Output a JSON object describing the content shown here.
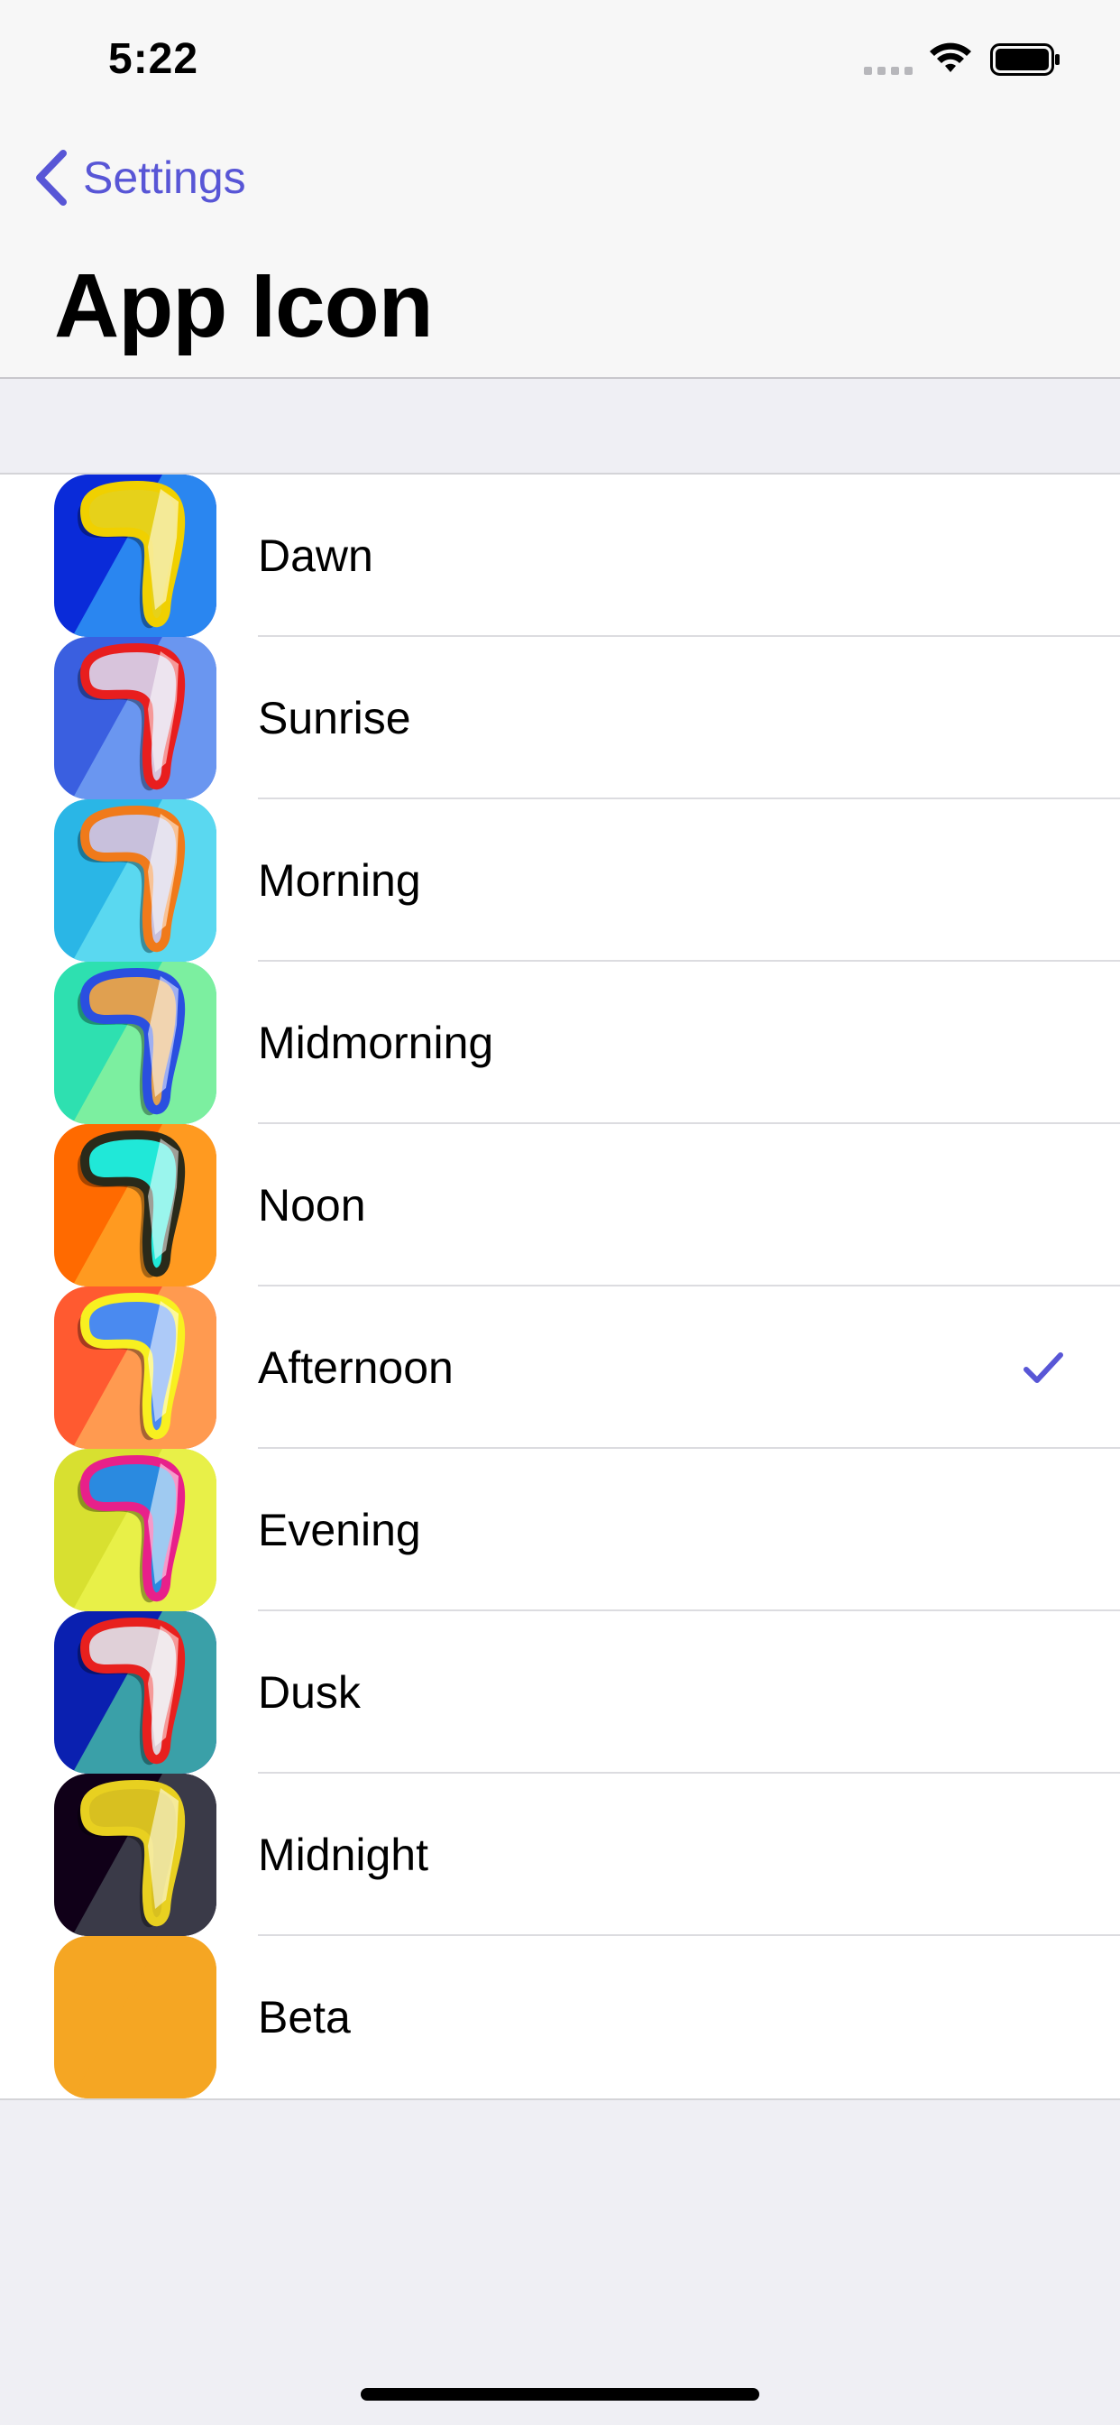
{
  "status_bar": {
    "time": "5:22",
    "signal_icon": "cellular-signal-icon",
    "wifi_icon": "wifi-icon",
    "battery_icon": "battery-icon"
  },
  "nav": {
    "back_label": "Settings",
    "back_icon": "chevron-left-icon",
    "title": "App Icon",
    "accent_color": "#5856d6"
  },
  "icons": [
    {
      "label": "Dawn",
      "selected": false,
      "bg1": "#0a2bd9",
      "bg2": "#2a86f0",
      "outline": "#f0d000",
      "fill": "#e6d11a"
    },
    {
      "label": "Sunrise",
      "selected": false,
      "bg1": "#3a5fe0",
      "bg2": "#6a96f0",
      "outline": "#e81e1e",
      "fill": "#d8c4dc"
    },
    {
      "label": "Morning",
      "selected": false,
      "bg1": "#2ab6e6",
      "bg2": "#5ad8f0",
      "outline": "#f07a1a",
      "fill": "#c8c0dc"
    },
    {
      "label": "Midmorning",
      "selected": false,
      "bg1": "#2ee0b0",
      "bg2": "#7cefa0",
      "outline": "#2a4fe0",
      "fill": "#e0a050"
    },
    {
      "label": "Noon",
      "selected": false,
      "bg1": "#ff6a00",
      "bg2": "#ff9a20",
      "outline": "#2a2a1a",
      "fill": "#20e8d8"
    },
    {
      "label": "Afternoon",
      "selected": true,
      "bg1": "#ff5a30",
      "bg2": "#ff9a50",
      "outline": "#f8f020",
      "fill": "#4a8af0"
    },
    {
      "label": "Evening",
      "selected": false,
      "bg1": "#d8e030",
      "bg2": "#e8f048",
      "outline": "#e8208a",
      "fill": "#2a8ae0"
    },
    {
      "label": "Dusk",
      "selected": false,
      "bg1": "#0a20b0",
      "bg2": "#3aa0a8",
      "outline": "#e8201e",
      "fill": "#e0d0d8"
    },
    {
      "label": "Midnight",
      "selected": false,
      "bg1": "#100018",
      "bg2": "#3a3a48",
      "outline": "#e8d020",
      "fill": "#d8c020"
    },
    {
      "label": "Beta",
      "selected": false,
      "bg1": "#f5a623",
      "bg2": "#f5a623",
      "outline": "",
      "fill": ""
    }
  ],
  "checkmark_icon": "checkmark-icon"
}
